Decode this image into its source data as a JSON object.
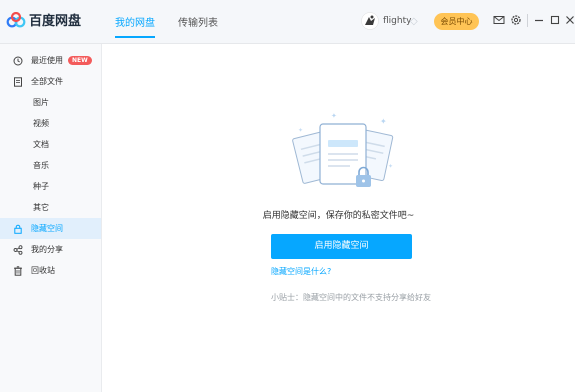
{
  "app": {
    "name": "百度网盘"
  },
  "tabs": [
    {
      "label": "我的网盘",
      "active": true
    },
    {
      "label": "传输列表",
      "active": false
    }
  ],
  "user": {
    "name": "flighty",
    "vip_label": "会员中心"
  },
  "icons": {
    "mail": "mail-icon",
    "settings": "gear-icon",
    "minimize": "minimize-icon",
    "maximize": "maximize-icon",
    "close": "close-icon"
  },
  "sidebar": {
    "items": [
      {
        "label": "最近使用",
        "icon": "clock-icon",
        "badge": "NEW"
      },
      {
        "label": "全部文件",
        "icon": "file-icon"
      },
      {
        "label": "图片"
      },
      {
        "label": "视频"
      },
      {
        "label": "文档"
      },
      {
        "label": "音乐"
      },
      {
        "label": "种子"
      },
      {
        "label": "其它"
      },
      {
        "label": "隐藏空间",
        "icon": "lock-icon",
        "active": true
      },
      {
        "label": "我的分享",
        "icon": "share-icon"
      },
      {
        "label": "回收站",
        "icon": "trash-icon"
      }
    ]
  },
  "main": {
    "tip": "启用隐藏空间，保存你的私密文件吧~",
    "enable_button": "启用隐藏空间",
    "what_link": "隐藏空间是什么?",
    "small_tip": "小贴士：隐藏空间中的文件不支持分享给好友"
  },
  "colors": {
    "accent": "#06a7ff",
    "vip": "#ffc455",
    "badge": "#f35b5b"
  }
}
